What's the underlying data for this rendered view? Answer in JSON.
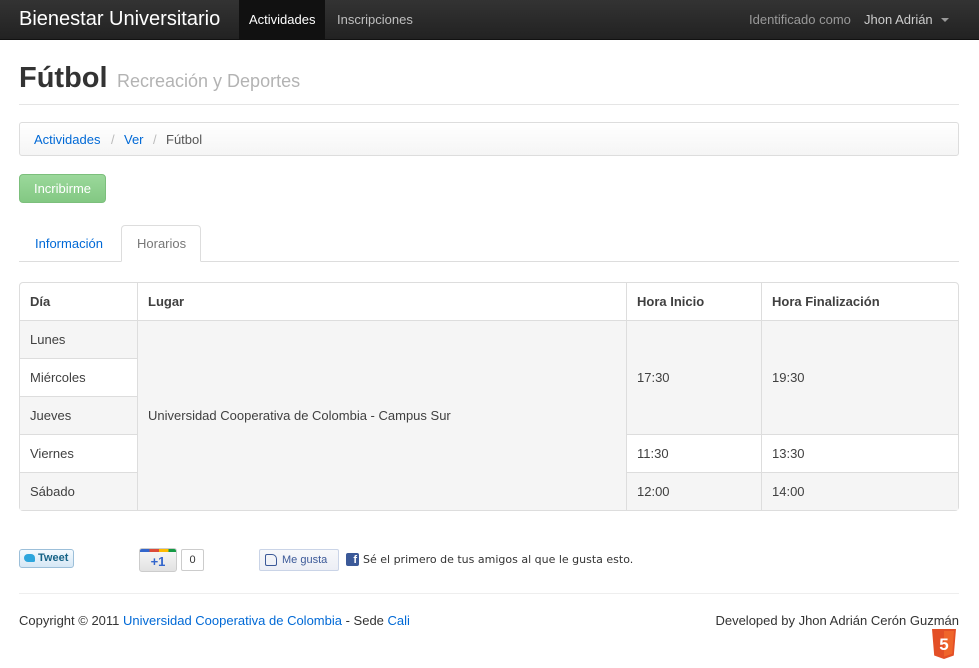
{
  "navbar": {
    "brand": "Bienestar Universitario",
    "items": [
      {
        "label": "Actividades",
        "active": true
      },
      {
        "label": "Inscripciones",
        "active": false
      }
    ],
    "identified_label": "Identificado como",
    "user_name": "Jhon Adrián"
  },
  "header": {
    "title": "Fútbol",
    "subtitle": "Recreación y Deportes"
  },
  "breadcrumb": {
    "items": [
      "Actividades",
      "Ver",
      "Fútbol"
    ],
    "separator": "/"
  },
  "actions": {
    "enroll_label": "Incribirme"
  },
  "tabs": [
    {
      "label": "Información",
      "active": false
    },
    {
      "label": "Horarios",
      "active": true
    }
  ],
  "schedule": {
    "headers": [
      "Día",
      "Lugar",
      "Hora Inicio",
      "Hora Finalización"
    ],
    "days": [
      "Lunes",
      "Miércoles",
      "Jueves",
      "Viernes",
      "Sábado"
    ],
    "place": "Universidad Cooperativa de Colombia - Campus Sur",
    "times": [
      {
        "start": "17:30",
        "end": "19:30"
      },
      {
        "start": "11:30",
        "end": "13:30"
      },
      {
        "start": "12:00",
        "end": "14:00"
      }
    ]
  },
  "social": {
    "tweet_label": "Tweet",
    "gplus_label": "+1",
    "gplus_count": "0",
    "like_label": "Me gusta",
    "facebook_letter": "f",
    "like_text": "Sé el primero de tus amigos al que le gusta esto."
  },
  "footer": {
    "copyright_prefix": "Copyright © 2011",
    "university_link": "Universidad Cooperativa de Colombia",
    "sede_text": "- Sede",
    "city_link": "Cali",
    "developer": "Developed by Jhon Adrián Cerón Guzmán",
    "html5_badge": "5"
  },
  "colors": {
    "link": "#0069d6",
    "navbar": "#222222",
    "success_button": "#8fd18f",
    "html5": "#e34f26"
  }
}
